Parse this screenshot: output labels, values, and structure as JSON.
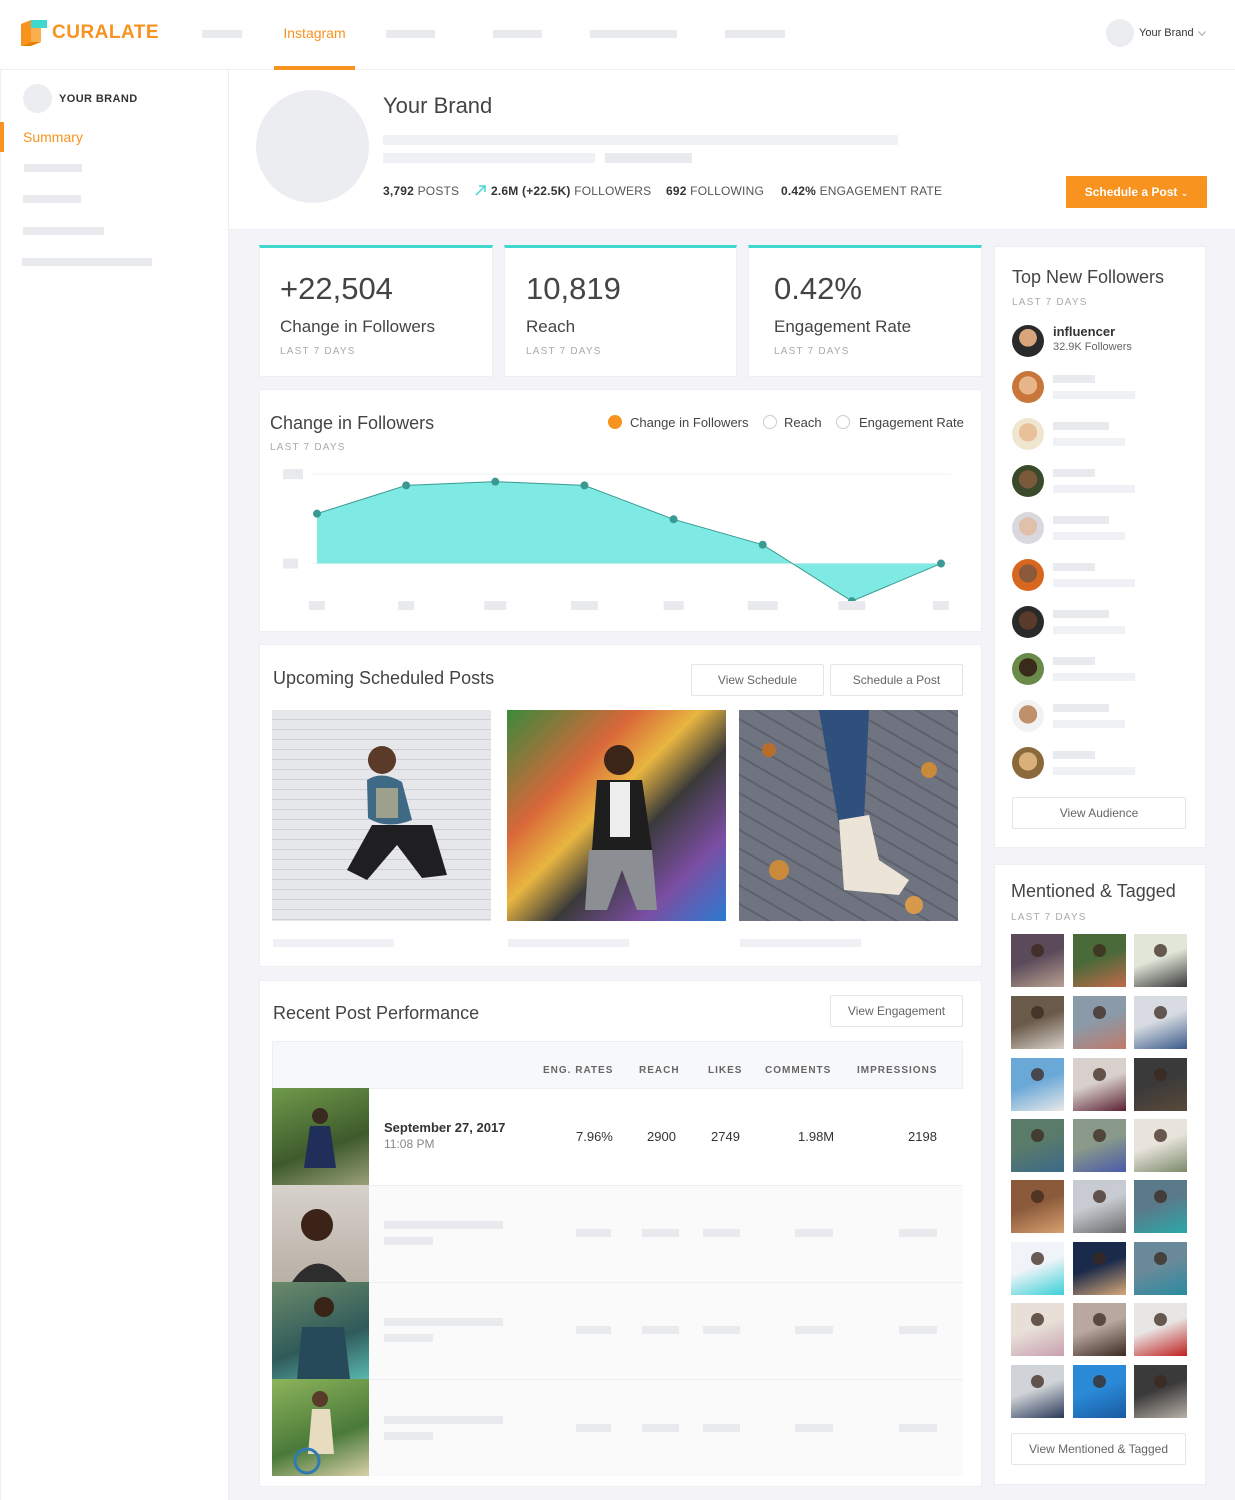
{
  "header": {
    "logo": "CURALATE",
    "nav_active": "Instagram",
    "brand_name": "Your Brand"
  },
  "sidebar": {
    "brand": "YOUR BRAND",
    "active_item": "Summary"
  },
  "profile": {
    "name": "Your Brand",
    "posts_value": "3,792",
    "posts_label": "POSTS",
    "followers_value": "2.6M (+22.5K)",
    "followers_label": "FOLLOWERS",
    "following_value": "692",
    "following_label": "FOLLOWING",
    "engagement_value": "0.42%",
    "engagement_label": "ENGAGEMENT RATE",
    "schedule_button": "Schedule a Post"
  },
  "kpis": [
    {
      "value": "+22,504",
      "label": "Change in Followers",
      "period": "LAST 7 DAYS"
    },
    {
      "value": "10,819",
      "label": "Reach",
      "period": "LAST 7 DAYS"
    },
    {
      "value": "0.42%",
      "label": "Engagement Rate",
      "period": "LAST 7 DAYS"
    }
  ],
  "chart_card": {
    "title": "Change in Followers",
    "period": "LAST 7 DAYS",
    "legend": [
      "Change in Followers",
      "Reach",
      "Engagement Rate"
    ]
  },
  "chart_data": {
    "type": "area",
    "title": "Change in Followers",
    "x": [
      1,
      2,
      3,
      4,
      5,
      6,
      7,
      8
    ],
    "series": [
      {
        "name": "Change in Followers",
        "values": [
          0.53,
          0.83,
          0.87,
          0.83,
          0.47,
          0.2,
          -0.4,
          0
        ]
      }
    ],
    "ylim": [
      -0.6,
      1.1
    ],
    "grid": true,
    "colors": {
      "line": "#3a9a93",
      "fill": "#7fe9e3"
    }
  },
  "scheduled": {
    "title": "Upcoming Scheduled Posts",
    "view_button": "View Schedule",
    "schedule_button": "Schedule a Post"
  },
  "performance": {
    "title": "Recent Post Performance",
    "view_button": "View Engagement",
    "columns": [
      "ENG. RATES",
      "REACH",
      "LIKES",
      "COMMENTS",
      "IMPRESSIONS"
    ],
    "row": {
      "date": "September 27, 2017",
      "time": "11:08 PM",
      "eng_rate": "7.96%",
      "reach": "2900",
      "likes": "2749",
      "comments": "1.98M",
      "impressions": "2198"
    }
  },
  "top_followers": {
    "title": "Top New Followers",
    "period": "LAST 7 DAYS",
    "first_name": "influencer",
    "first_followers": "32.9K Followers",
    "button": "View Audience"
  },
  "mentioned": {
    "title": "Mentioned & Tagged",
    "period": "LAST 7 DAYS",
    "button": "View Mentioned & Tagged"
  },
  "colors": {
    "accent": "#f7931e",
    "teal": "#3fd8cf"
  }
}
